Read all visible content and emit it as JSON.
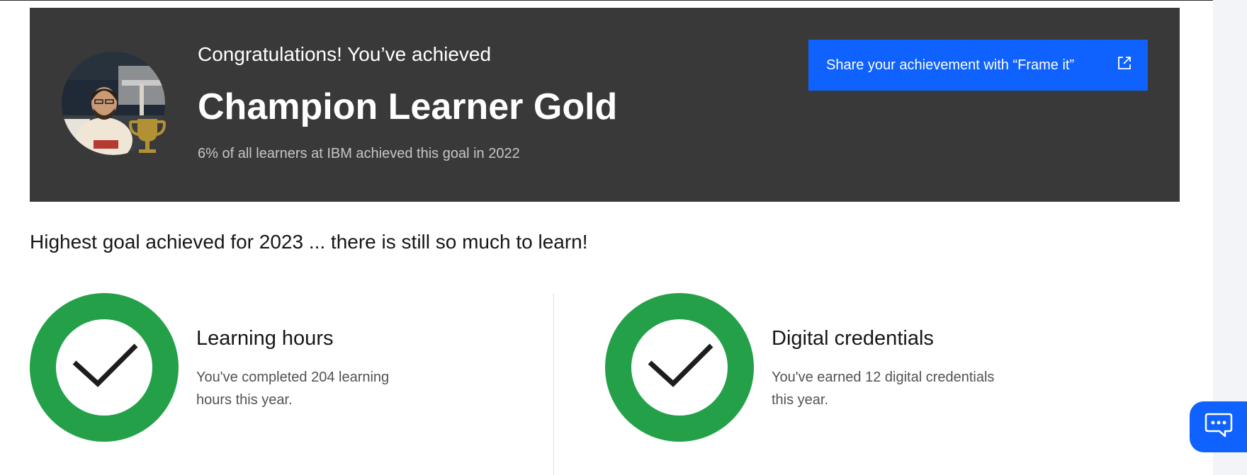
{
  "banner": {
    "congrats_text": "Congratulations! You’ve achieved",
    "achievement_title": "Champion Learner Gold",
    "achievement_stat": "6% of all learners at IBM achieved this goal in 2022",
    "share_button_label": "Share your achievement with “Frame it”",
    "share_icon": "external-link-icon",
    "trophy_icon": "trophy-icon",
    "trophy_color": "#b29135",
    "background_color": "#393939",
    "button_color": "#0f62fe"
  },
  "subheading": "Highest goal achieved for 2023 ... there is still so much to learn!",
  "goals": [
    {
      "title": "Learning hours",
      "description": "You've completed 204 learning hours this year.",
      "status_icon": "checkmark-icon",
      "ring_color": "#24a148"
    },
    {
      "title": "Digital credentials",
      "description": "You've earned 12 digital credentials this year.",
      "status_icon": "checkmark-icon",
      "ring_color": "#24a148"
    }
  ],
  "chat": {
    "icon": "chat-bubble-icon"
  }
}
